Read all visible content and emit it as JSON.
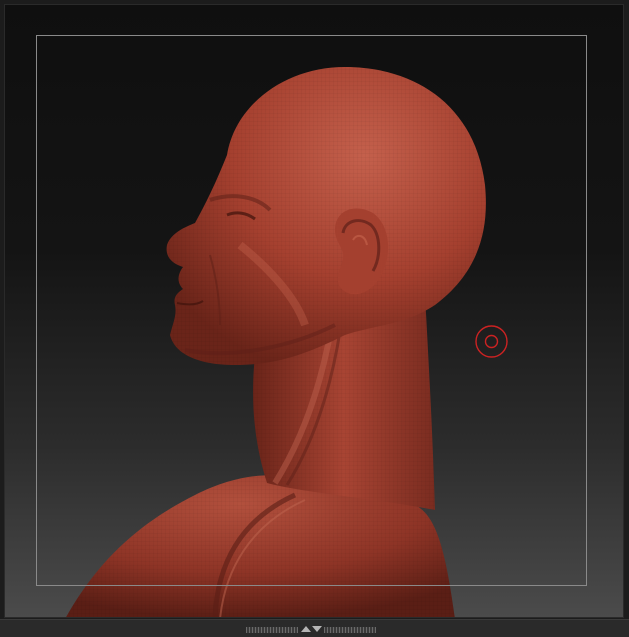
{
  "app": {
    "name": "sculpt-viewport"
  },
  "viewport": {
    "background_top": "#0f0f0f",
    "background_bottom": "#4b4b4b",
    "frame_color": "#8a8a8a"
  },
  "model": {
    "skin_color": "#9a3a2e",
    "shadow_color": "#5e2018",
    "highlight_color": "#c25a48"
  },
  "brush_cursor": {
    "color": "#cc2222"
  },
  "bottom_bar": {
    "icons": [
      "scroll-grip-left-icon",
      "collapse-arrows-icon",
      "scroll-grip-right-icon"
    ]
  }
}
